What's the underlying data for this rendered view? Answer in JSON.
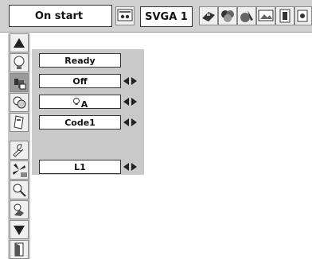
{
  "topbar": {
    "mode_label": "On start",
    "signal_label": "SVGA 1",
    "icons": [
      "input-icon",
      "tv-icon",
      "color-icon",
      "pc-adjust-icon",
      "screen-icon",
      "image-icon",
      "setting-icon"
    ]
  },
  "sidebar": {
    "icons": [
      "up-arrow-icon",
      "lamp-icon",
      "key-lock-icon",
      "lamp-counter-icon",
      "remote-control-icon",
      "wrench-icon",
      "fan-icon",
      "filter-icon",
      "security-icon",
      "down-arrow-icon",
      "exit-icon"
    ]
  },
  "panel": {
    "rows": [
      {
        "value": "Ready",
        "has_arrows": false
      },
      {
        "value": "Off",
        "has_arrows": true
      },
      {
        "value": "A",
        "has_arrows": true
      },
      {
        "value": "Code1",
        "has_arrows": true
      },
      {
        "value": "L1",
        "has_arrows": true
      }
    ]
  },
  "colors": {
    "bar": "#d0d0d0",
    "panel": "#c9c9c9",
    "selected": "#9a9a9a"
  }
}
